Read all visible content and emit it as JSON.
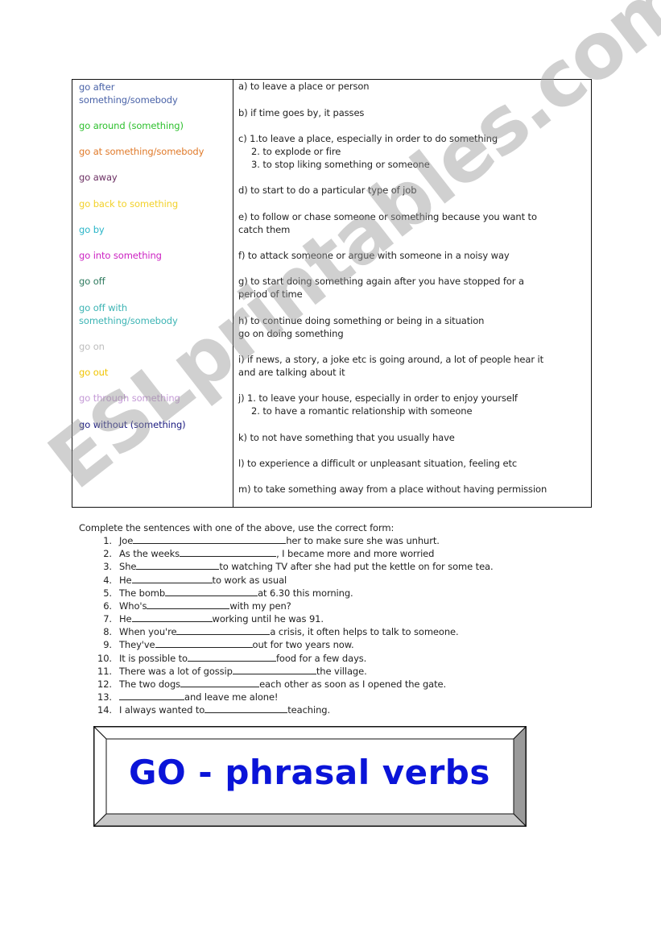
{
  "vocab": {
    "verbs": [
      {
        "text": "go after something/somebody",
        "line1": "go after",
        "line2": "something/somebody",
        "color": "#4a63a8"
      },
      {
        "text": "go around (something)",
        "color": "#2ec02e"
      },
      {
        "text": "go at something/somebody",
        "color": "#e07a2a"
      },
      {
        "text": "go away",
        "color": "#6b2f62"
      },
      {
        "text": "go back to something",
        "color": "#f2d12a"
      },
      {
        "text": "go by",
        "color": "#2ab5c8"
      },
      {
        "text": "go into something",
        "color": "#cc22c2"
      },
      {
        "text": "go off",
        "color": "#2e7a5e"
      },
      {
        "text": "go off with something/somebody",
        "line1": "go off with",
        "line2": "something/somebody",
        "color": "#3cb4b4"
      },
      {
        "text": "go on",
        "color": "#bdbdbd"
      },
      {
        "text": "go out",
        "color": "#f0c400"
      },
      {
        "text": "go through something",
        "color": "#c49ad6"
      },
      {
        "text": "go without (something)",
        "color": "#1a1a80"
      }
    ],
    "definitions": [
      {
        "lines": [
          "a) to leave a place or person"
        ]
      },
      {
        "lines": [
          "b) if time goes by, it passes"
        ]
      },
      {
        "lines": [
          "c) 1.to leave a place, especially in order to do something"
        ],
        "subs": [
          "2. to explode or fire",
          "3. to stop liking something or someone"
        ]
      },
      {
        "lines": [
          "d) to start to do a particular type of job"
        ]
      },
      {
        "lines": [
          "e) to follow or chase someone or something because you want to",
          "catch them"
        ]
      },
      {
        "lines": [
          "f) to attack someone or argue with someone in a noisy way"
        ]
      },
      {
        "lines": [
          "g) to start doing something again after you have stopped for a",
          "period of time"
        ]
      },
      {
        "lines": [
          "h) to continue doing something or being in a situation",
          "go on doing something"
        ]
      },
      {
        "lines": [
          "i) if news, a story, a joke etc is going around, a lot of people hear it",
          "and are talking about it"
        ]
      },
      {
        "lines": [
          "j) 1. to leave your house, especially in order to enjoy yourself"
        ],
        "subs": [
          "2. to have a romantic relationship with someone"
        ]
      },
      {
        "lines": [
          "k) to not have something that you usually have"
        ]
      },
      {
        "lines": [
          "l) to experience a difficult or unpleasant situation, feeling etc"
        ]
      },
      {
        "lines": [
          "m) to take something away from a place without having permission"
        ]
      }
    ]
  },
  "exercise": {
    "instruction": "Complete the sentences with one of the above, use the correct form:",
    "items": [
      {
        "num": "1.",
        "before": "Joe ",
        "after": "her to make sure she was unhurt."
      },
      {
        "num": "2.",
        "before": "As the weeks",
        "after": ", I became more and more worried"
      },
      {
        "num": "3.",
        "before": "She ",
        "after": "to watching TV after she had put the kettle on for some tea."
      },
      {
        "num": "4.",
        "before": "He ",
        "after": " to work as usual"
      },
      {
        "num": "5.",
        "before": "The bomb ",
        "after": "at 6.30 this morning."
      },
      {
        "num": "6.",
        "before": "Who's ",
        "after": "with my pen?"
      },
      {
        "num": "7.",
        "before": "He ",
        "after": "working until he was 91."
      },
      {
        "num": "8.",
        "before": "When you're ",
        "after": "a crisis, it often helps to talk to someone."
      },
      {
        "num": "9.",
        "before": "They've ",
        "after": "out for two years now."
      },
      {
        "num": "10.",
        "before": "It is possible to ",
        "after": " food for a few days."
      },
      {
        "num": "11.",
        "before": "There was a lot of gossip ",
        "after": " the village."
      },
      {
        "num": "12.",
        "before": "The two dogs ",
        "after": " each other as soon as I opened the gate."
      },
      {
        "num": "13.",
        "before": "",
        "after": " and leave me alone!"
      },
      {
        "num": "14.",
        "before": "I always wanted to ",
        "after": " teaching."
      }
    ]
  },
  "title": {
    "text": "GO - phrasal verbs",
    "color": "#0a14d8"
  },
  "watermark": {
    "text": "ESLprintables.com"
  }
}
